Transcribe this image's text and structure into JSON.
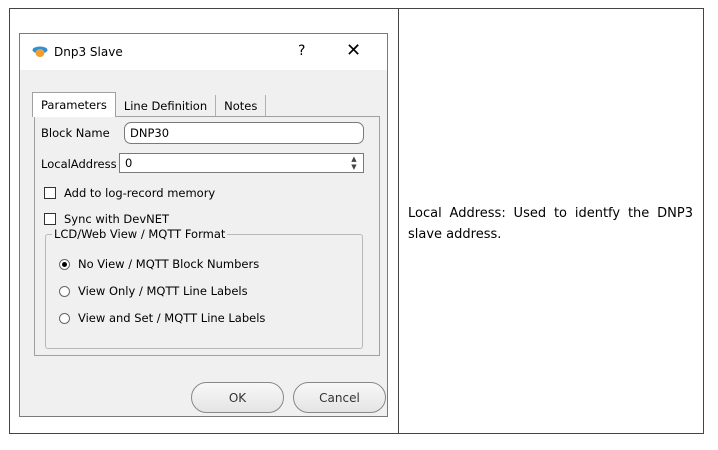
{
  "dialog": {
    "title": "Dnp3 Slave",
    "help_glyph": "?",
    "close_glyph": "✕",
    "icon": "blue-orange-app-icon"
  },
  "tabs": [
    {
      "label": "Parameters",
      "active": true
    },
    {
      "label": "Line Definition",
      "active": false
    },
    {
      "label": "Notes",
      "active": false
    }
  ],
  "form": {
    "block_name_label": "Block Name",
    "block_name_value": "DNP30",
    "local_address_label": "LocalAddress",
    "local_address_value": "0",
    "log_record_label": "Add to log-record memory",
    "log_record_checked": false,
    "sync_devnet_label": "Sync with DevNET",
    "sync_devnet_checked": false
  },
  "group": {
    "legend": "LCD/Web View / MQTT Format",
    "options": [
      {
        "label": "No View / MQTT Block Numbers",
        "checked": true
      },
      {
        "label": "View Only / MQTT Line Labels",
        "checked": false
      },
      {
        "label": "View and Set / MQTT Line Labels",
        "checked": false
      }
    ]
  },
  "buttons": {
    "ok": "OK",
    "cancel": "Cancel"
  },
  "description": "Local Address: Used to identfy the DNP3 slave address."
}
